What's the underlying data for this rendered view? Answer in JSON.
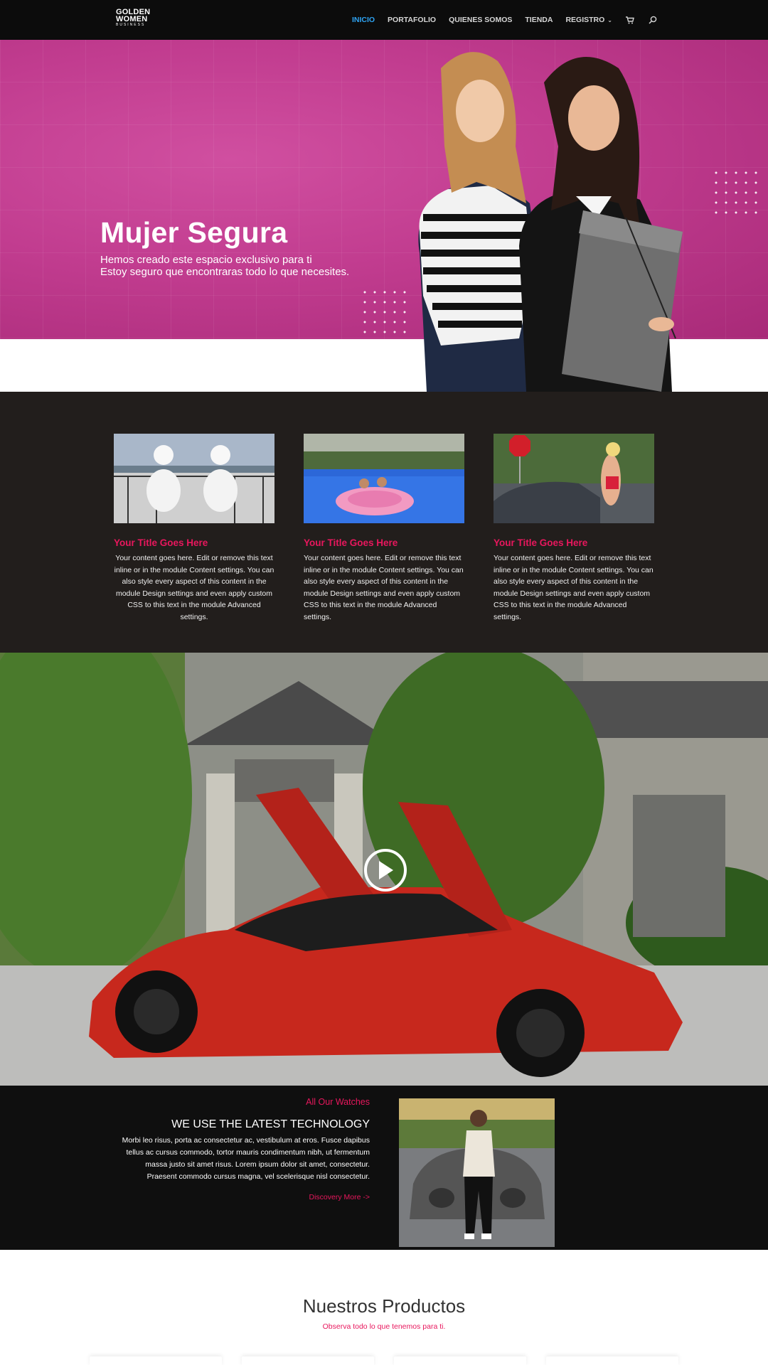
{
  "nav": {
    "logo": {
      "line1": "GOLDEN",
      "line2": "WOMEN",
      "line3": "BUSINESS"
    },
    "items": [
      {
        "label": "INICIO",
        "active": true
      },
      {
        "label": "PORTAFOLIO",
        "active": false
      },
      {
        "label": "QUIENES SOMOS",
        "active": false
      },
      {
        "label": "TIENDA",
        "active": false
      },
      {
        "label": "REGISTRO",
        "active": false,
        "has_dropdown": true
      }
    ],
    "icons": [
      "cart-icon",
      "search-icon"
    ],
    "accent": "#2ea3f2"
  },
  "hero": {
    "title": "Mujer Segura",
    "subtitle_line1": "Hemos creado este espacio exclusivo para ti",
    "subtitle_line2": "Estoy seguro que encontraras todo lo que necesites.",
    "background": "#c13c8f"
  },
  "features": {
    "background": "#221e1c",
    "title_color": "#e8175d",
    "cards": [
      {
        "title": "Your Title Goes Here",
        "text": "Your content goes here. Edit or remove this text inline or in the module Content settings. You can also style every aspect of this content in the module Design settings and even apply custom CSS to this text in the module Advanced settings."
      },
      {
        "title": "Your Title Goes Here",
        "text": "Your content goes here. Edit or remove this text inline or in the module Content settings. You can also style every aspect of this content in the module Design settings and even apply custom CSS to this text in the module Advanced settings."
      },
      {
        "title": "Your Title Goes Here",
        "text": "Your content goes here. Edit or remove this text inline or in the module Content settings. You can also style every aspect of this content in the module Design settings and even apply custom CSS to this text in the module Advanced settings."
      }
    ]
  },
  "video": {
    "icon": "play-icon"
  },
  "tech": {
    "kicker": "All Our Watches",
    "title": "WE USE THE LATEST TECHNOLOGY",
    "body": "Morbi leo risus, porta ac consectetur ac, vestibulum at eros. Fusce dapibus tellus ac cursus commodo, tortor mauris condimentum nibh, ut fermentum massa justo sit amet risus. Lorem ipsum dolor sit amet, consectetur. Praesent commodo cursus magna, vel scelerisque nisl consectetur.",
    "link": "Discovery More ->"
  },
  "products": {
    "title": "Nuestros Productos",
    "subtitle": "Observa todo lo que tenemos para ti."
  }
}
